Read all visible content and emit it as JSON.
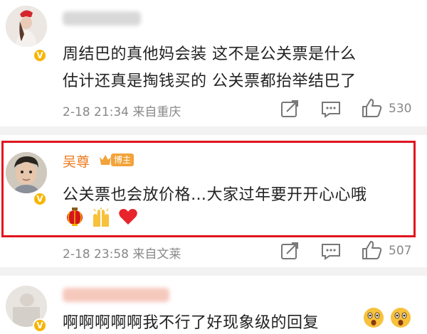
{
  "colors": {
    "highlight_border": "#e0141e",
    "verified_badge": "#f7b500",
    "name_orange": "#ee7a1c",
    "meta_gray": "#888888"
  },
  "comments": [
    {
      "author_visible": false,
      "verified_icon": "v-badge",
      "text_lines": [
        "周结巴的真他妈会装 这不是公关票是什么",
        "估计还真是掏钱买的 公关票都抬举结巴了"
      ],
      "date": "2-18",
      "time": "21:34",
      "source": "来自重庆",
      "likes": "530"
    },
    {
      "author": "吴尊",
      "author_badge": "博主",
      "verified_icon": "v-badge",
      "highlighted": true,
      "text_lines": [
        "公关票也会放价格…大家过年要开开心心哦"
      ],
      "emojis": [
        "red-lantern-emoji",
        "raised-hands-emoji",
        "red-heart-emoji"
      ],
      "date": "2-18",
      "time": "23:58",
      "source": "来自文莱",
      "likes": "507"
    },
    {
      "author_visible": false,
      "verified_icon": "v-badge",
      "text_lines": [
        "啊啊啊啊啊我不行了好现象级的回复"
      ],
      "emojis": [
        "astonished-face-emoji",
        "astonished-face-emoji"
      ]
    }
  ]
}
